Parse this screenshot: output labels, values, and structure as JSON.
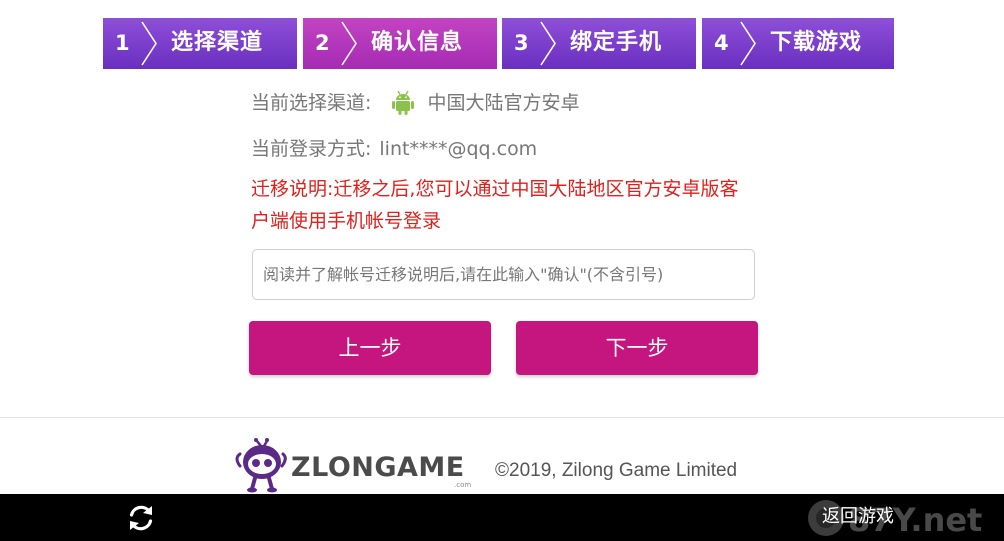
{
  "steps": [
    {
      "num": "1",
      "label": "选择渠道"
    },
    {
      "num": "2",
      "label": "确认信息"
    },
    {
      "num": "3",
      "label": "绑定手机"
    },
    {
      "num": "4",
      "label": "下载游戏"
    }
  ],
  "info": {
    "channel_label": "当前选择渠道:",
    "channel_value": "中国大陆官方安卓",
    "login_label": "当前登录方式:",
    "login_value": "lint****@qq.com",
    "migrate_text": "迁移说明:迁移之后,您可以通过中国大陆地区官方安卓版客户端使用手机帐号登录"
  },
  "confirm_input": {
    "placeholder": "阅读并了解帐号迁移说明后,请在此输入\"确认\"(不含引号)",
    "value": ""
  },
  "buttons": {
    "prev": "上一步",
    "next": "下一步"
  },
  "footer": {
    "logo_text": "ZLONGAME",
    "logo_sub": ".com",
    "copyright": "©2019, Zilong Game Limited"
  },
  "bottom_bar": {
    "return_label": "返回游戏",
    "watermark": "87Y.net"
  },
  "icons": {
    "android": "android-icon",
    "refresh": "refresh-icon",
    "step_chevron": "chevron-right-icon"
  },
  "colors": {
    "step_bg": "#7a3ccb",
    "step_active_bg": "#b33cb8",
    "button_bg": "#c4167e",
    "warning_text": "#e0201c",
    "android_green": "#8bc34a"
  }
}
